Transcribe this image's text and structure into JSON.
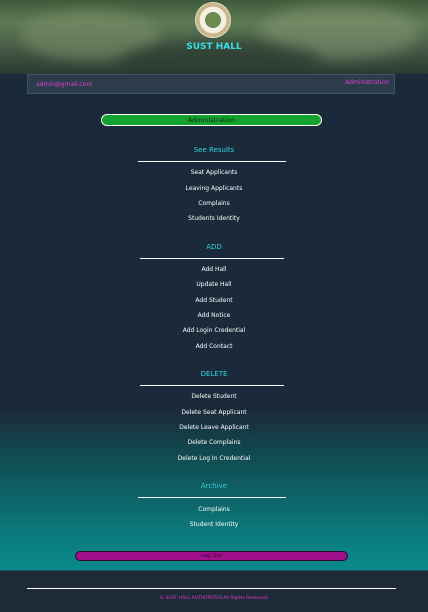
{
  "header": {
    "brand": "SUST HALL"
  },
  "navbar": {
    "email": "admin@gmail.com",
    "admin_link": "Administration"
  },
  "admin_bar": {
    "label": "Administration"
  },
  "sections": [
    {
      "title": "See Results",
      "items": [
        "Seat Applicants",
        "Leaving Applicants",
        "Complains",
        "Students Identity"
      ]
    },
    {
      "title": "ADD",
      "items": [
        "Add Hall",
        "Update Hall",
        "Add Student",
        "Add Notice",
        "Add Login Credential",
        "Add Contact"
      ]
    },
    {
      "title": "DELETE",
      "items": [
        "Delete Student",
        "Delete Seat Applicant",
        "Delete Leave Applicant",
        "Delete Complains",
        "Delete Log In Credential"
      ]
    },
    {
      "title": "Archive",
      "items": [
        "Complains",
        "Student Identity"
      ]
    }
  ],
  "logout": {
    "label": "Log Out"
  },
  "footer": {
    "text": "© SUST HALL AUTHORITIES.All Rights Reserved."
  },
  "colors": {
    "accent": "#33d3dc",
    "pink": "#e23fd4",
    "green": "#13a22b",
    "magenta": "#a0108a"
  }
}
